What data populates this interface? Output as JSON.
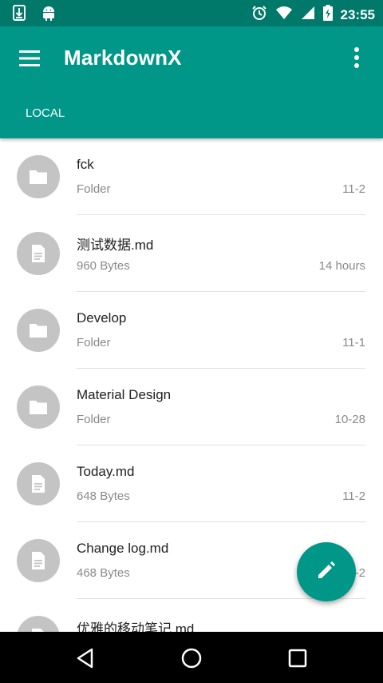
{
  "status_bar": {
    "left_icons": [
      "download-icon",
      "android-icon"
    ],
    "right_icons": [
      "alarm-icon",
      "wifi-icon",
      "signal-icon",
      "battery-charging-icon"
    ],
    "time": "23:55"
  },
  "app_bar": {
    "title": "MarkdownX",
    "menu_icon": "hamburger-menu-icon",
    "more_icon": "more-vert-icon",
    "tab": "LOCAL"
  },
  "files": [
    {
      "name": "fck",
      "meta": "Folder",
      "date": "11-2",
      "icon": "folder-icon"
    },
    {
      "name": "测试数据.md",
      "meta": "960 Bytes",
      "date": "14 hours",
      "icon": "document-icon"
    },
    {
      "name": "Develop",
      "meta": "Folder",
      "date": "11-1",
      "icon": "folder-icon"
    },
    {
      "name": "Material Design",
      "meta": "Folder",
      "date": "10-28",
      "icon": "folder-icon"
    },
    {
      "name": "Today.md",
      "meta": "648 Bytes",
      "date": "11-2",
      "icon": "document-icon"
    },
    {
      "name": "Change log.md",
      "meta": "468 Bytes",
      "date": "11-2",
      "icon": "document-icon"
    },
    {
      "name": "优雅的移动笔记.md",
      "meta": "",
      "date": "",
      "icon": "document-icon"
    }
  ],
  "fab": {
    "icon": "edit-pencil-icon"
  },
  "nav_bar": {
    "icons": [
      "back-icon",
      "home-icon",
      "recents-icon"
    ]
  },
  "colors": {
    "primary": "#009688",
    "primary_dark": "#00796b",
    "avatar_bg": "#c4c4c4"
  }
}
